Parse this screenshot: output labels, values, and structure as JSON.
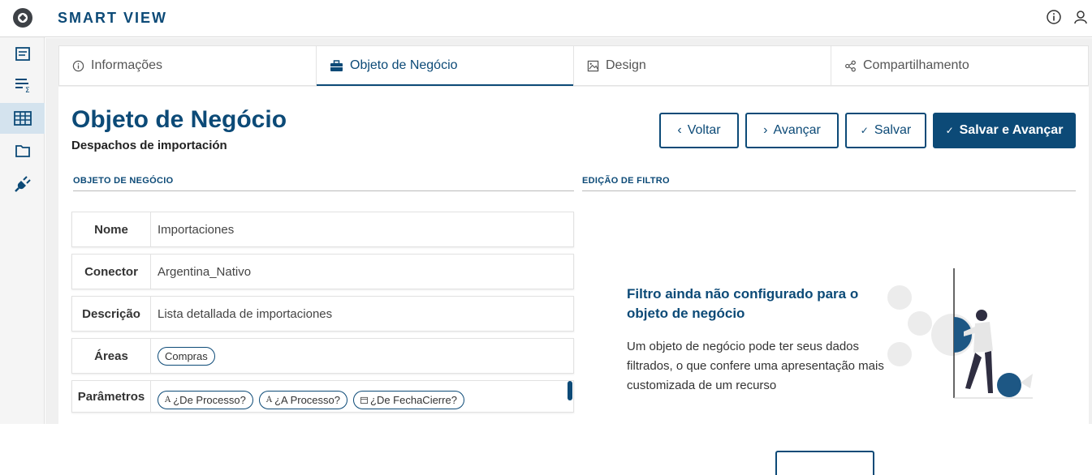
{
  "header": {
    "app_title": "SMART VIEW"
  },
  "tabs": [
    {
      "label": "Informações",
      "icon": "info-icon",
      "active": false
    },
    {
      "label": "Objeto de Negócio",
      "icon": "briefcase-icon",
      "active": true
    },
    {
      "label": "Design",
      "icon": "image-icon",
      "active": false
    },
    {
      "label": "Compartilhamento",
      "icon": "share-icon",
      "active": false
    }
  ],
  "page": {
    "title": "Objeto de Negócio",
    "subtitle": "Despachos de importación"
  },
  "toolbar": {
    "back_label": "Voltar",
    "next_label": "Avançar",
    "save_label": "Salvar",
    "save_next_label": "Salvar e Avançar"
  },
  "sections": {
    "business_object": "OBJETO DE NEGÓCIO",
    "filter_edit": "EDIÇÃO DE FILTRO"
  },
  "form": {
    "name_label": "Nome",
    "name_value": "Importaciones",
    "connector_label": "Conector",
    "connector_value": "Argentina_Nativo",
    "description_label": "Descrição",
    "description_value": "Lista detallada de importaciones",
    "areas_label": "Áreas",
    "areas": [
      "Compras"
    ],
    "params_label": "Parâmetros",
    "params": [
      {
        "label": "¿De Processo?",
        "icon": "text-type-icon"
      },
      {
        "label": "¿A Processo?",
        "icon": "text-type-icon"
      },
      {
        "label": "¿De FechaCierre?",
        "icon": "calendar-icon"
      }
    ]
  },
  "filter_empty": {
    "title": "Filtro ainda não configurado para o objeto de negócio",
    "text": "Um objeto de negócio pode ter seus dados filtrados, o que confere uma apresentação mais customizada de um recurso"
  },
  "colors": {
    "primary": "#0c4a77",
    "sidebar_active": "#d4e3ee",
    "illustration_circle": "#1d5784"
  }
}
